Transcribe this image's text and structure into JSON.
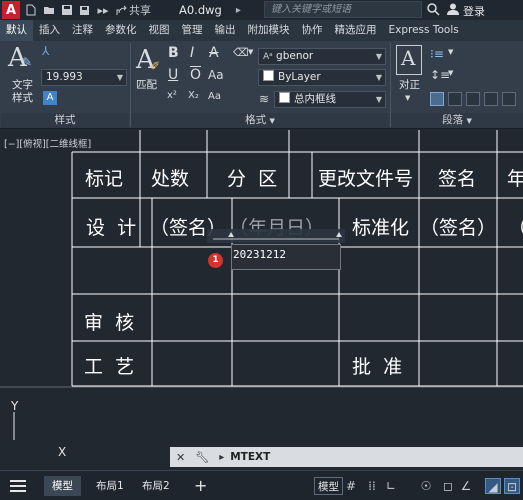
{
  "titlebar": {
    "app_logo": "A",
    "share_label": "共享",
    "doc_title": "A0.dwg",
    "title_sep": "▸",
    "search_placeholder": "键入关键字或短语",
    "login_label": "登录"
  },
  "ribbon_tabs": [
    "默认",
    "插入",
    "注释",
    "参数化",
    "视图",
    "管理",
    "输出",
    "附加模块",
    "协作",
    "精选应用",
    "Express Tools"
  ],
  "active_tab_index": 0,
  "ribbon": {
    "text_style_label_1": "文字",
    "text_style_label_2": "样式",
    "text_height_value": "19.993",
    "match_label": "匹配",
    "font_value": "gbenor",
    "color_value": "ByLayer",
    "bg_value": "总内框线",
    "panel_style": "样式",
    "panel_format": "格式",
    "panel_paragraph": "段落",
    "align_label": "对正"
  },
  "view_label": "[−][俯视][二维线框]",
  "table": {
    "row1": [
      "标记",
      "处数",
      "分  区",
      "更改文件号",
      "签名",
      "年"
    ],
    "row2": [
      "设  计",
      "（签名）",
      "（年月日）",
      "标准化",
      "（签名）",
      "（"
    ],
    "row4": [
      "审  核"
    ],
    "row5": [
      "工  艺",
      "批  准"
    ]
  },
  "mtext": {
    "value": "20231212",
    "badge": "1"
  },
  "ucs": {
    "y_label": "Y",
    "x_label": "X"
  },
  "cmdline": {
    "prompt_icon": "▸",
    "command": "MTEXT"
  },
  "statusbar": {
    "tabs": [
      "模型",
      "布局1",
      "布局2"
    ],
    "add_tab": "+",
    "model_button": "模型"
  }
}
